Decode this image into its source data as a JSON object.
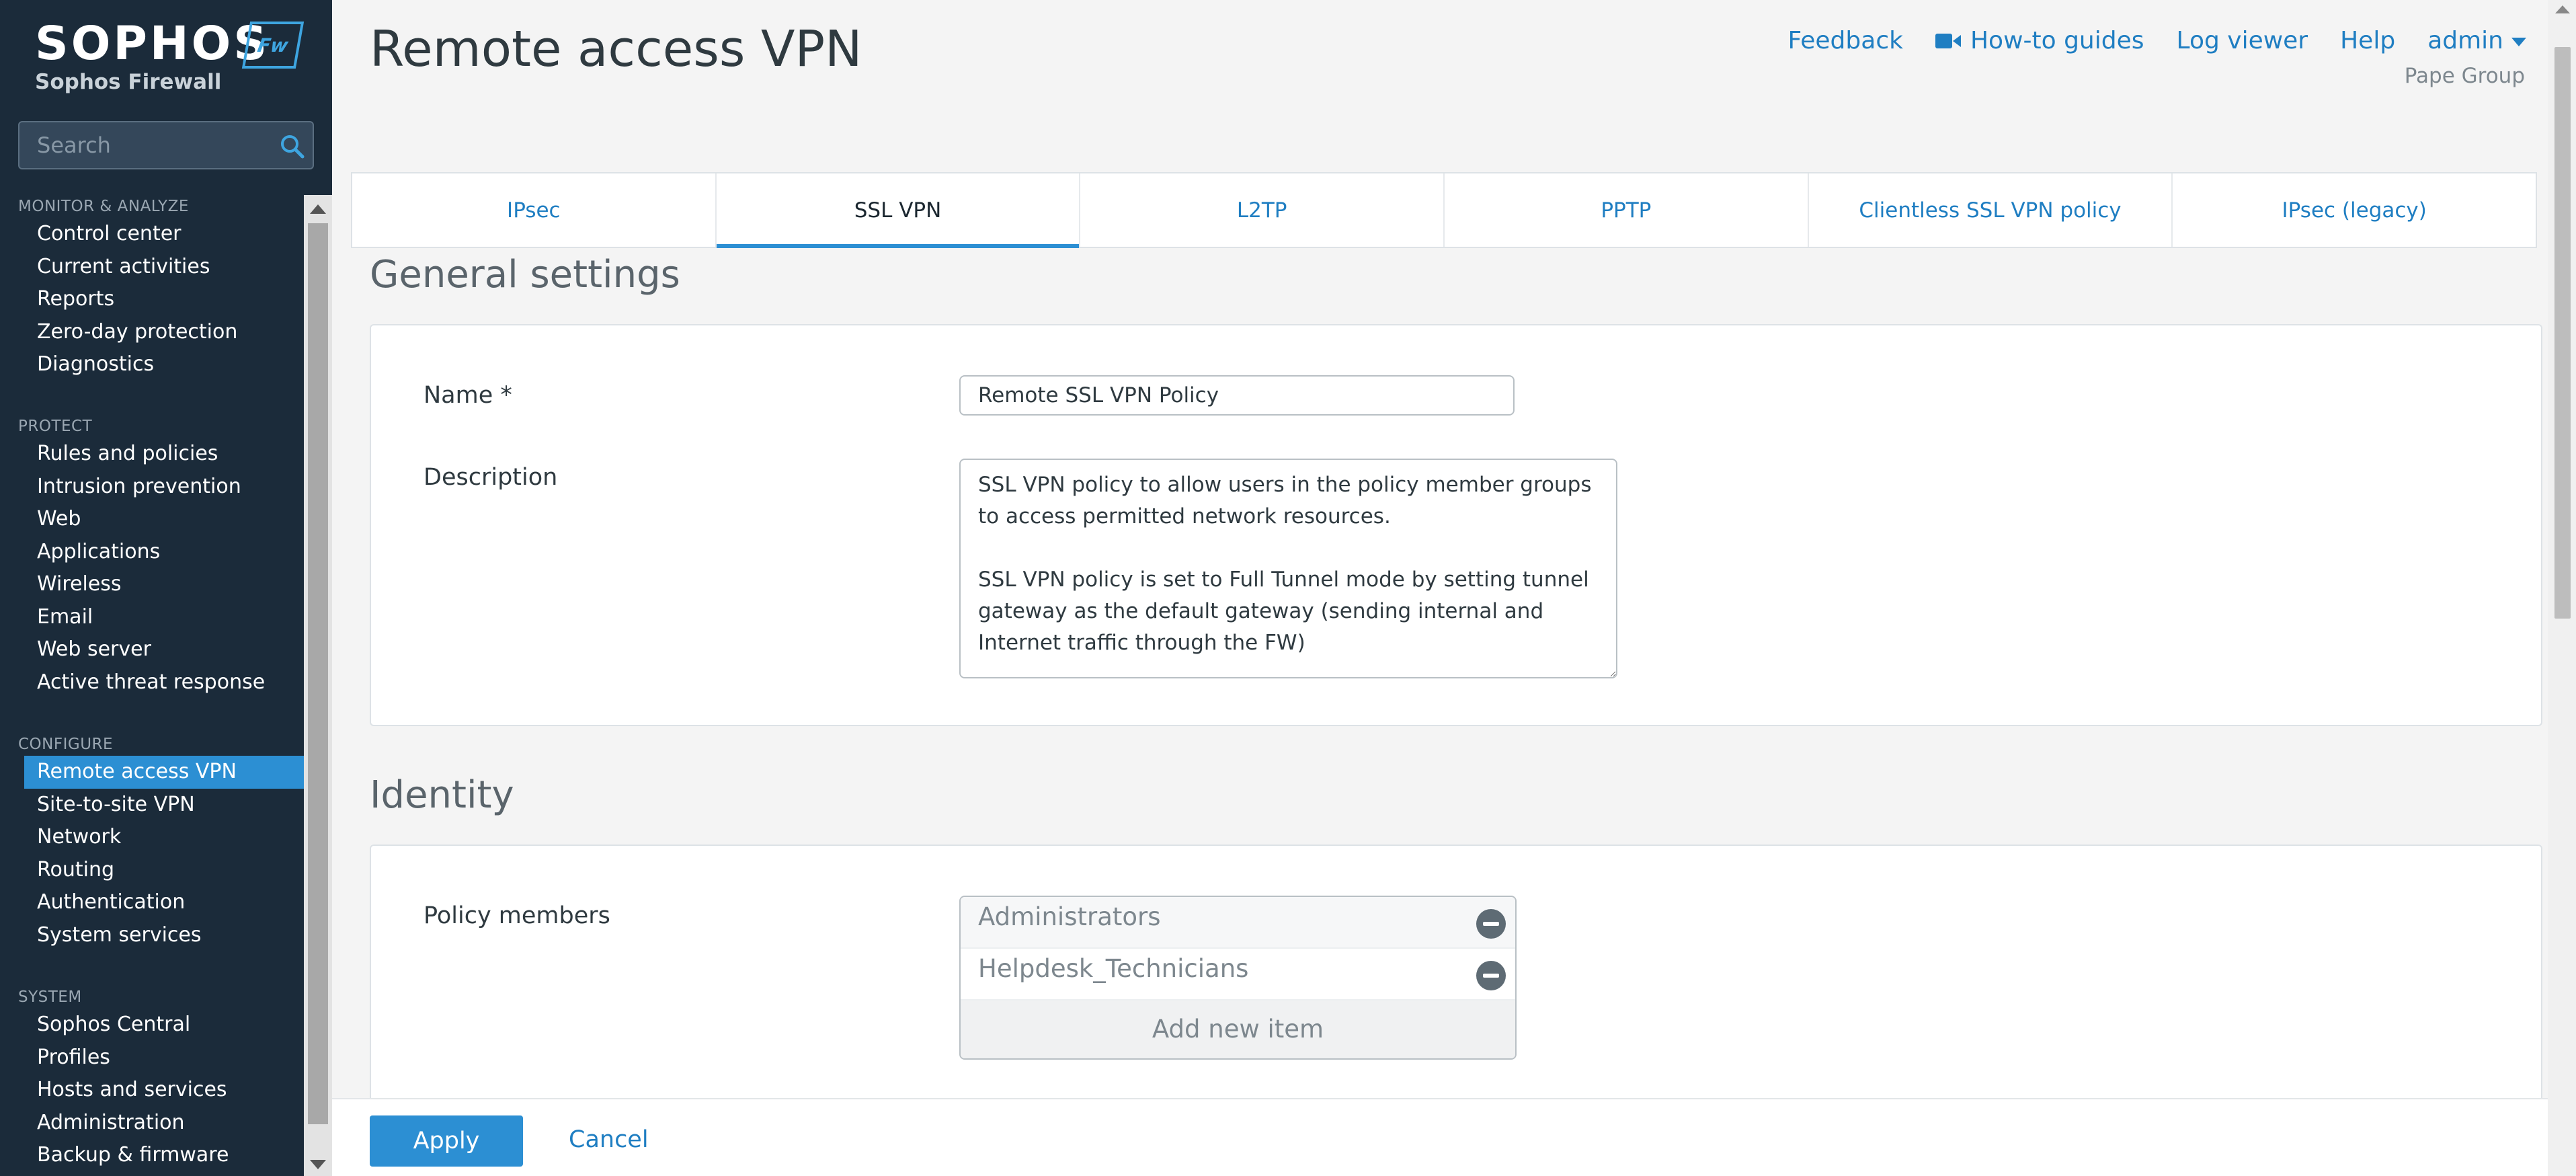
{
  "logo": {
    "brand": "SOPHOS",
    "badge": "Fw",
    "product": "Sophos Firewall"
  },
  "search": {
    "placeholder": "Search"
  },
  "sidebar": {
    "sections": [
      {
        "heading": "MONITOR & ANALYZE",
        "items": [
          "Control center",
          "Current activities",
          "Reports",
          "Zero-day protection",
          "Diagnostics"
        ]
      },
      {
        "heading": "PROTECT",
        "items": [
          "Rules and policies",
          "Intrusion prevention",
          "Web",
          "Applications",
          "Wireless",
          "Email",
          "Web server",
          "Active threat response"
        ]
      },
      {
        "heading": "CONFIGURE",
        "items": [
          "Remote access VPN",
          "Site-to-site VPN",
          "Network",
          "Routing",
          "Authentication",
          "System services"
        ]
      },
      {
        "heading": "SYSTEM",
        "items": [
          "Sophos Central",
          "Profiles",
          "Hosts and services",
          "Administration",
          "Backup & firmware"
        ]
      }
    ],
    "active_item": "Remote access VPN"
  },
  "header": {
    "title": "Remote access VPN",
    "links": {
      "feedback": "Feedback",
      "howto": "How-to guides",
      "log_viewer": "Log viewer",
      "help": "Help",
      "admin": "admin"
    },
    "org": "Pape Group"
  },
  "tabs": [
    {
      "label": "IPsec",
      "active": false
    },
    {
      "label": "SSL VPN",
      "active": true
    },
    {
      "label": "L2TP",
      "active": false
    },
    {
      "label": "PPTP",
      "active": false
    },
    {
      "label": "Clientless SSL VPN policy",
      "active": false
    },
    {
      "label": "IPsec (legacy)",
      "active": false
    }
  ],
  "general": {
    "title": "General settings",
    "name_label": "Name *",
    "name_value": "Remote SSL VPN Policy",
    "description_label": "Description",
    "description_value": "SSL VPN policy to allow users in the policy member groups to access permitted network resources.\n\nSSL VPN policy is set to Full Tunnel mode by setting tunnel gateway as the default gateway (sending internal and Internet traffic through the FW)"
  },
  "identity": {
    "title": "Identity",
    "members_label": "Policy members",
    "members": [
      "Administrators",
      "Helpdesk_Technicians"
    ],
    "add_item": "Add new item"
  },
  "footer": {
    "apply": "Apply",
    "cancel": "Cancel"
  },
  "colors": {
    "sidebar_bg": "#1b2b3a",
    "accent": "#2c8fd3",
    "link": "#1f7ec2"
  }
}
